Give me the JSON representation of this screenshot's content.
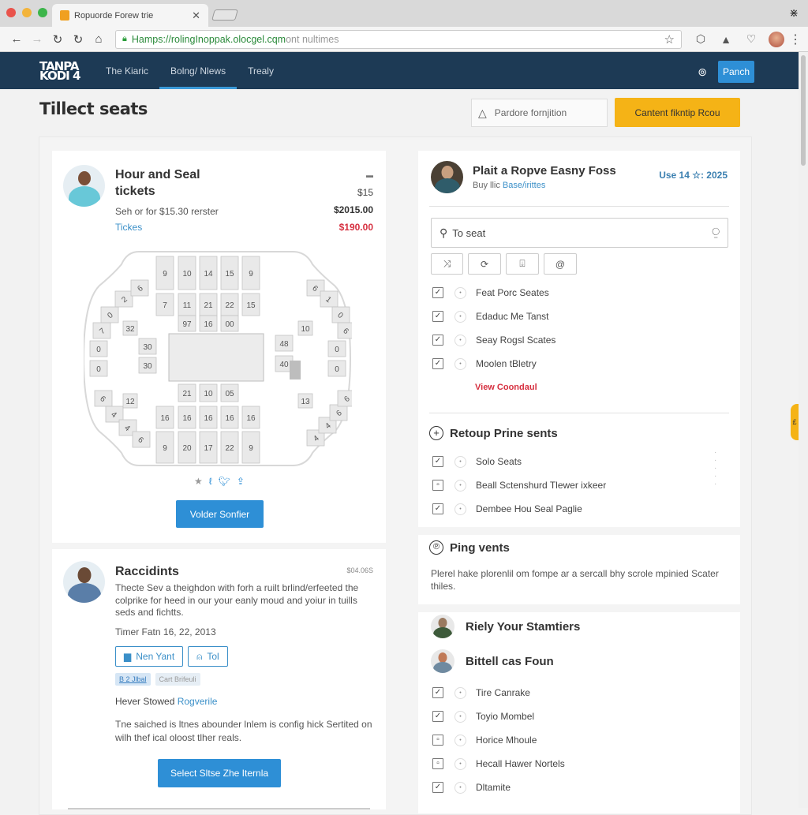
{
  "browser": {
    "tab_title": "Ropuorde Forew trie",
    "tab_close": "✕",
    "url_host": "Hamps://rolingInoppak.olocgel.cqm",
    "url_rest": "ont nultimes",
    "window_control": "⋇"
  },
  "navbar": {
    "logo_line1": "TANPA",
    "logo_line2": "KODI 4",
    "links": [
      "The Kiaric",
      "Bolng/ Nlews",
      "Trealy"
    ],
    "active_link": 1,
    "action_button": "Panch"
  },
  "page": {
    "title": "Tillect seats",
    "outline_button": "Pardore fornjition",
    "primary_button": "Cantent fikntip Rcou"
  },
  "ticket_card": {
    "title": "Hour and Seal tickets",
    "subtitle": "Seh or for $15.30 rerster",
    "link": "Tickes",
    "prices": [
      "$15",
      "$2015.00",
      "$190.00"
    ],
    "price_alert_color": "#d63040",
    "venue_sections": {
      "top_row": [
        "9",
        "10",
        "14",
        "15",
        "9"
      ],
      "second_row": [
        "7",
        "11",
        "21",
        "22",
        "15"
      ],
      "inner_top": [
        "97",
        "16",
        "00"
      ],
      "inner_left": [
        "30",
        "30"
      ],
      "inner_right": [
        "48",
        "40"
      ],
      "inner_bottom": [
        "21",
        "10",
        "05"
      ],
      "lower_row": [
        "16",
        "16",
        "16",
        "16",
        "16"
      ],
      "bottom_row": [
        "9",
        "20",
        "17",
        "22",
        "9"
      ]
    },
    "share_icons": [
      "star-icon",
      "link-icon",
      "twitter-icon",
      "share-icon"
    ],
    "button": "Volder Sonfier"
  },
  "review_card": {
    "title": "Raccidints",
    "meta": "$04.06S",
    "description": "Thecte Sev a theighdon with forh a ruilt brlind/erfeeted the colprike for heed in our your eanly moud and yoiur in tuills seds and fichtts.",
    "date": "Timer Fatn 16, 22, 2013",
    "buttons": [
      "Nen Yant",
      "Tol"
    ],
    "tags": [
      "B 2 Jlbal",
      "Cart Brifeuli"
    ],
    "saved_label": "Hever Stowed",
    "saved_link": "Rogverile",
    "note": "Tne saiched is ltnes abounder lnlem is config hick Sertited on wilh thef ical oloost tlher reals.",
    "button": "Select Sltse Zhe Iternla"
  },
  "sidebar": {
    "header_name": "Plait a Ropve Easny Foss",
    "header_sub": "Buy llic",
    "header_sub_link": "Base/irittes",
    "header_date": "Use 14 ☆: 2025",
    "search_placeholder": "To seat",
    "filter_icons": [
      "shuffle-icon",
      "share-icon",
      "download-icon",
      "at-icon"
    ],
    "list1": [
      {
        "label": "Feat Porc Seates",
        "checked": true
      },
      {
        "label": "Edaduc Me Tanst",
        "checked": true
      },
      {
        "label": "Seay Rogsl Scates",
        "checked": true
      },
      {
        "label": "Moolen tBletry",
        "checked": true
      }
    ],
    "view_link": "View Coondaul",
    "section2_title": "Retoup Prine sents",
    "list2": [
      {
        "label": "Solo Seats",
        "checked": true
      },
      {
        "label": "Beall Sctenshurd Tlewer ixkeer",
        "checked": false
      },
      {
        "label": "Dembee Hou Seal Paglie",
        "checked": true
      }
    ],
    "section3_title": "Ping vents",
    "section3_desc": "Plerel hake plorenlil om fompe ar a sercall bhy scrole mpinied Scater thiles.",
    "person1": "Riely Your Stamtiers",
    "person2": "Bittell cas Foun",
    "list3": [
      {
        "label": "Tire Canrake",
        "checked": true
      },
      {
        "label": "Toyio Mombel",
        "checked": true
      },
      {
        "label": "Horice Mhoule",
        "checked": false
      },
      {
        "label": "Hecall Hawer Nortels",
        "checked": false
      },
      {
        "label": "Dltamite",
        "checked": true
      }
    ]
  },
  "colors": {
    "navbar": "#1d3a55",
    "accent_blue": "#2e8fd6",
    "accent_yellow": "#f5b316",
    "link_red": "#d63040"
  }
}
